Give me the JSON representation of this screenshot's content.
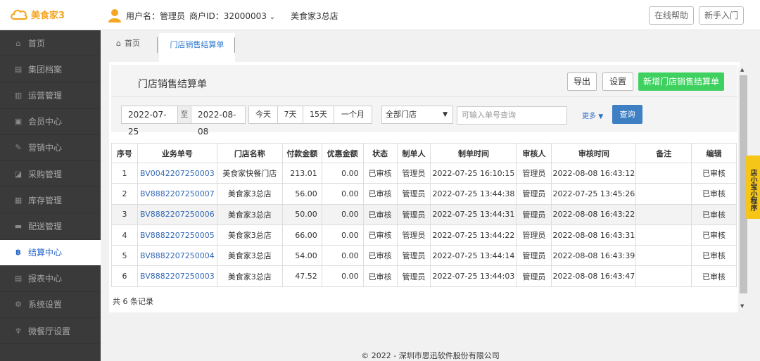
{
  "app": {
    "logo_text": "美食家3"
  },
  "user": {
    "username": "用户名：管理员",
    "merchant": "商户ID：32000003",
    "merchant_caret": "⌄",
    "store": "美食家3总店"
  },
  "top_buttons": {
    "help": "在线帮助",
    "guide": "新手入门"
  },
  "sidebar": {
    "items": [
      {
        "label": "首页",
        "icon": "home-icon"
      },
      {
        "label": "集团档案",
        "icon": "archive-icon"
      },
      {
        "label": "运营管理",
        "icon": "bar-chart-icon"
      },
      {
        "label": "会员中心",
        "icon": "member-card-icon"
      },
      {
        "label": "营销中心",
        "icon": "edit-icon"
      },
      {
        "label": "采购管理",
        "icon": "purchase-icon"
      },
      {
        "label": "库存管理",
        "icon": "inventory-icon"
      },
      {
        "label": "配送管理",
        "icon": "truck-icon"
      },
      {
        "label": "结算中心",
        "icon": "bitcoin-icon",
        "active": true
      },
      {
        "label": "报表中心",
        "icon": "report-icon"
      },
      {
        "label": "系统设置",
        "icon": "gears-icon"
      },
      {
        "label": "微餐厅设置",
        "icon": "cutlery-icon"
      }
    ]
  },
  "tabs": {
    "home": "首页",
    "active": "门店销售结算单"
  },
  "panel": {
    "title": "门店销售结算单",
    "export": "导出",
    "settings": "设置",
    "add": "新增门店销售结算单"
  },
  "filter": {
    "date_from": "2022-07-25",
    "to_label": "至",
    "date_to": "2022-08-08",
    "ranges": [
      "今天",
      "7天",
      "15天",
      "一个月"
    ],
    "store_select": "全部门店",
    "search_placeholder": "可输入单号查询",
    "more": "更多",
    "query": "查询"
  },
  "table": {
    "columns": [
      "序号",
      "业务单号",
      "门店名称",
      "付款金额",
      "优惠金额",
      "状态",
      "制单人",
      "制单时间",
      "审核人",
      "审核时间",
      "备注",
      "编辑"
    ],
    "rows": [
      [
        "1",
        "BV0042207250003",
        "美食家快餐门店",
        "213.01",
        "0.00",
        "已审核",
        "管理员",
        "2022-07-25 16:10:15",
        "管理员",
        "2022-08-08 16:43:12",
        "",
        "已审核"
      ],
      [
        "2",
        "BV8882207250007",
        "美食家3总店",
        "56.00",
        "0.00",
        "已审核",
        "管理员",
        "2022-07-25 13:44:38",
        "管理员",
        "2022-07-25 13:45:26",
        "",
        "已审核"
      ],
      [
        "3",
        "BV8882207250006",
        "美食家3总店",
        "50.00",
        "0.00",
        "已审核",
        "管理员",
        "2022-07-25 13:44:31",
        "管理员",
        "2022-08-08 16:43:22",
        "",
        "已审核"
      ],
      [
        "4",
        "BV8882207250005",
        "美食家3总店",
        "66.00",
        "0.00",
        "已审核",
        "管理员",
        "2022-07-25 13:44:22",
        "管理员",
        "2022-08-08 16:43:31",
        "",
        "已审核"
      ],
      [
        "5",
        "BV8882207250004",
        "美食家3总店",
        "54.00",
        "0.00",
        "已审核",
        "管理员",
        "2022-07-25 13:44:14",
        "管理员",
        "2022-08-08 16:43:39",
        "",
        "已审核"
      ],
      [
        "6",
        "BV8882207250003",
        "美食家3总店",
        "47.52",
        "0.00",
        "已审核",
        "管理员",
        "2022-07-25 13:44:03",
        "管理员",
        "2022-08-08 16:43:47",
        "",
        "已审核"
      ]
    ]
  },
  "total": "共 6 条记录",
  "widget": "店小宝小程序",
  "footer": "© 2022 - 深圳市思迅软件股份有限公司",
  "colors": {
    "accent": "#2f7ad0",
    "add_button": "#3fd160",
    "query_button": "#3f7fc3",
    "sidebar_bg": "#3a3a3a",
    "logo": "#f5a623",
    "widget": "#f5c518"
  }
}
